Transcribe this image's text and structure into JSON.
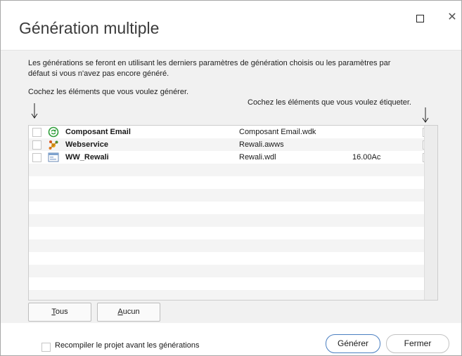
{
  "window": {
    "title": "Génération multiple"
  },
  "info_text": {
    "line1": "Les générations se feront en utilisant les derniers paramètres de génération choisis ou les paramètres par",
    "line2": "défaut si vous n'avez pas encore généré."
  },
  "hint_left": "Cochez les éléments que vous voulez générer.",
  "hint_right": "Cochez les éléments que vous voulez étiqueter.",
  "rows": [
    {
      "name": "Composant Email",
      "file": "Composant Email.wdk",
      "version": "",
      "icon": "green-refresh-icon"
    },
    {
      "name": "Webservice",
      "file": "Rewali.awws",
      "version": "",
      "icon": "webservice-icon"
    },
    {
      "name": "WW_Rewali",
      "file": "Rewali.wdl",
      "version": "16.00Ac",
      "icon": "window-project-icon"
    }
  ],
  "buttons": {
    "all_first": "T",
    "all_rest": "ous",
    "none_first": "A",
    "none_rest": "ucun",
    "generate": "Générer",
    "close": "Fermer"
  },
  "recompile_label": "Recompiler le projet avant les générations",
  "window_controls": {
    "maximize": "maximize-icon",
    "close": "close-icon"
  }
}
